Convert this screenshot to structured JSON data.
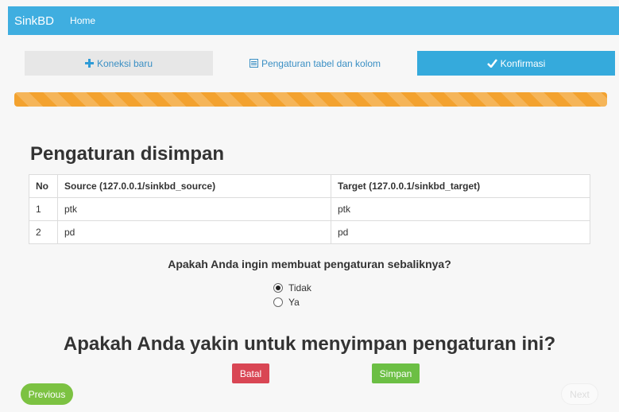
{
  "navbar": {
    "brand": "SinkBD",
    "home": "Home"
  },
  "steps": [
    {
      "label": "Koneksi baru",
      "icon": "plus-icon"
    },
    {
      "label": "Pengaturan tabel dan kolom",
      "icon": "list-icon"
    },
    {
      "label": "Konfirmasi",
      "icon": "check-icon"
    }
  ],
  "progress": {
    "value": 1.0,
    "color": "#f3a22f"
  },
  "heading": "Pengaturan disimpan",
  "table": {
    "headers": [
      "No",
      "Source (127.0.0.1/sinkbd_source)",
      "Target (127.0.0.1/sinkbd_target)"
    ],
    "rows": [
      [
        "1",
        "ptk",
        "ptk"
      ],
      [
        "2",
        "pd",
        "pd"
      ]
    ]
  },
  "reverse_question": "Apakah Anda ingin membuat pengaturan sebaliknya?",
  "radio_options": [
    {
      "label": "Tidak",
      "checked": true
    },
    {
      "label": "Ya",
      "checked": false
    }
  ],
  "confirm_question": "Apakah Anda yakin untuk menyimpan pengaturan ini?",
  "buttons": {
    "cancel": "Batal",
    "save": "Simpan",
    "previous": "Previous",
    "next": "Next"
  },
  "colors": {
    "navbar": "#3faee0",
    "active_step": "#35aadc",
    "cancel": "#d94654",
    "save": "#6cbf44",
    "previous": "#7cc242"
  }
}
